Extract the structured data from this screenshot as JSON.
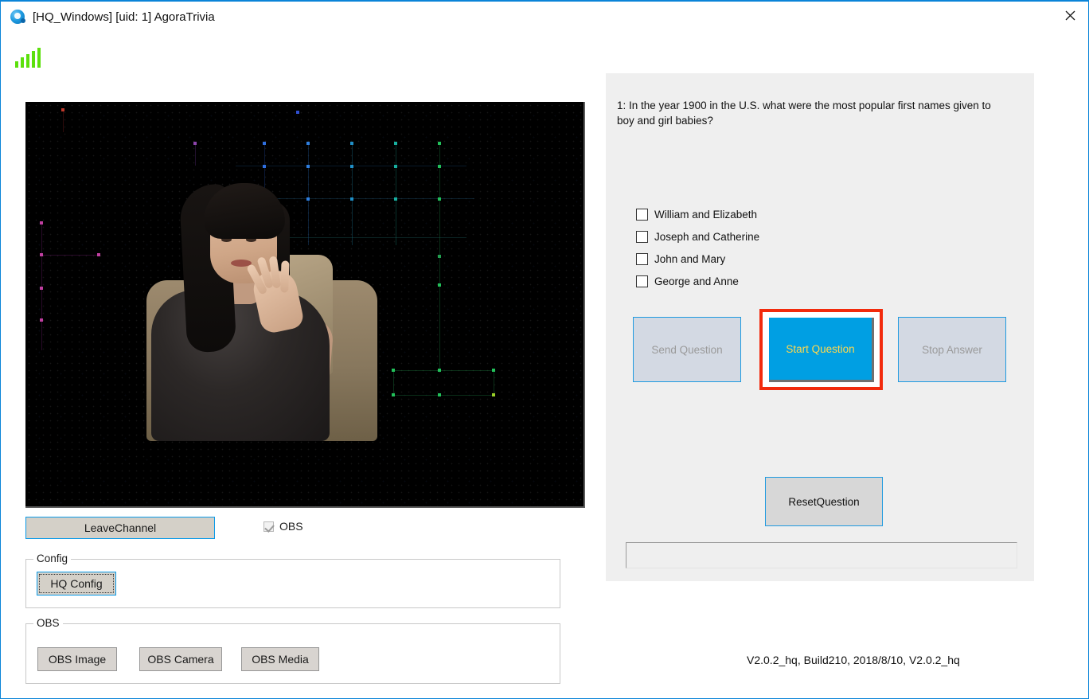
{
  "window": {
    "title": "[HQ_Windows] [uid: 1] AgoraTrivia",
    "close_label": "✕",
    "app_icon": "agora-app-icon"
  },
  "status": {
    "signal_icon": "signal-bars-icon",
    "signal_bars": 5,
    "signal_color": "#5ce00c"
  },
  "video": {
    "name": "local-video-preview",
    "description": "live video of a host seated in a studio chair on a dark dotted backdrop"
  },
  "left_controls": {
    "leave_channel_label": "LeaveChannel",
    "obs_checkbox_label": "OBS",
    "obs_checkbox_checked": true,
    "obs_checkbox_enabled": false,
    "config_group_title": "Config",
    "hq_config_label": "HQ Config",
    "obs_group_title": "OBS",
    "obs_buttons": [
      {
        "label": "OBS Image"
      },
      {
        "label": "OBS Camera"
      },
      {
        "label": "OBS Media"
      }
    ]
  },
  "question_panel": {
    "question": "1: In the year 1900 in the U.S. what were the most popular first names given to boy and girl babies?",
    "options": [
      {
        "label": "William and Elizabeth",
        "checked": false
      },
      {
        "label": "Joseph and Catherine",
        "checked": false
      },
      {
        "label": "John and Mary",
        "checked": false
      },
      {
        "label": "George and Anne",
        "checked": false
      }
    ],
    "send_question_label": "Send Question",
    "send_question_enabled": false,
    "start_question_label": "Start Question",
    "start_question_enabled": true,
    "start_question_highlighted": true,
    "stop_answer_label": "Stop Answer",
    "stop_answer_enabled": false,
    "reset_question_label": "ResetQuestion",
    "status_field_value": "",
    "status_field_placeholder": ""
  },
  "footer": {
    "version": "V2.0.2_hq, Build210, 2018/8/10, V2.0.2_hq"
  },
  "colors": {
    "accent_blue": "#009fe3",
    "accent_yellow": "#ffd84d",
    "highlight_red": "#f22a0c",
    "panel_gray": "#efefef",
    "signal_green": "#5ce00c"
  }
}
